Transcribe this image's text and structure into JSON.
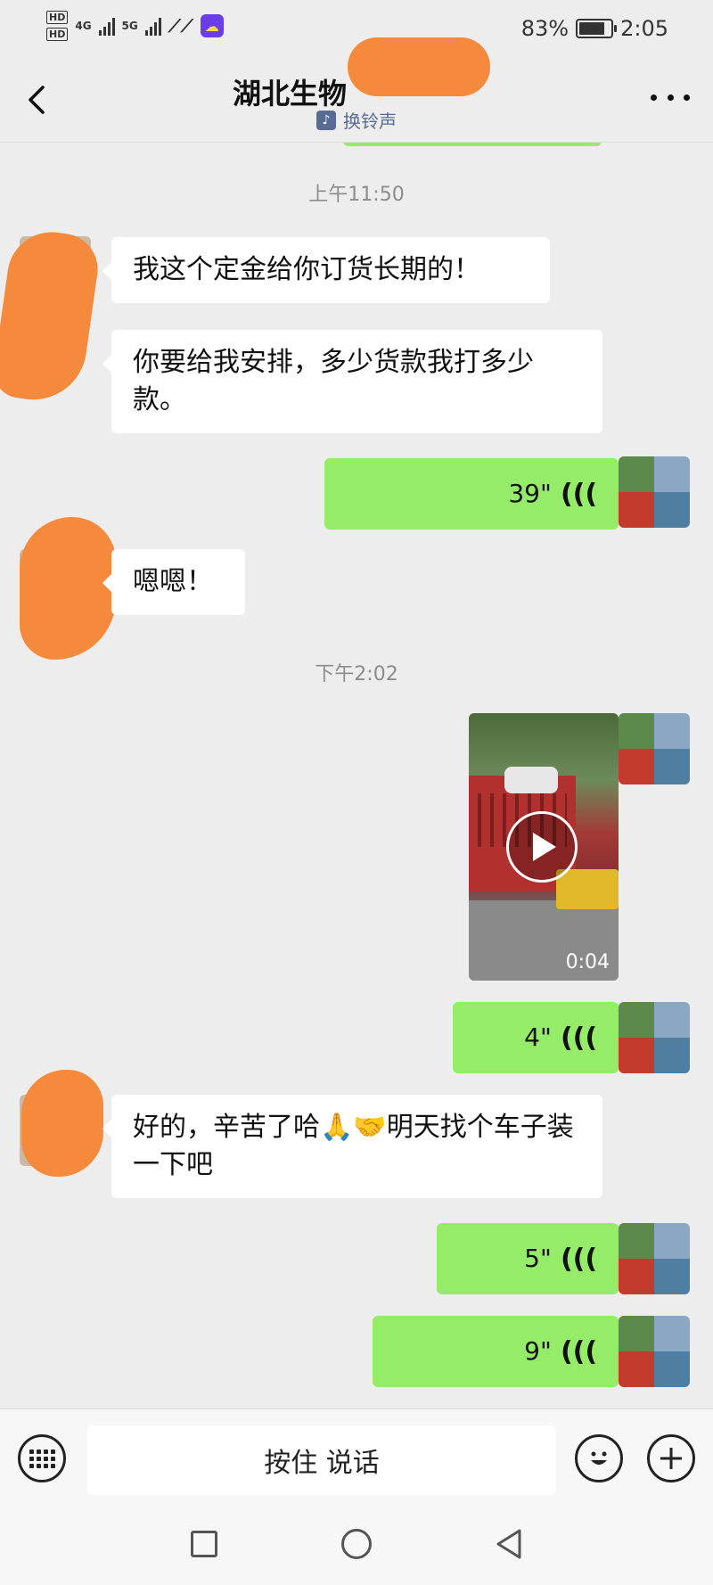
{
  "status_bar": {
    "sim1": "HD",
    "sim2": "HD",
    "net1": "4G",
    "net2": "5G",
    "battery": "83%",
    "battery_level": 0.83,
    "time": "2:05"
  },
  "header": {
    "title": "湖北生物",
    "subtitle": "换铃声"
  },
  "messages": {
    "ts1": "上午11:50",
    "m1": "我这个定金给你订货长期的！",
    "m2": "你要给我安排，多少货款我打多少款。",
    "v1": "39\"",
    "m3": "嗯嗯！",
    "ts2": "下午2:02",
    "video_duration": "0:04",
    "v2": "4\"",
    "m4": "好的，辛苦了哈🙏🤝明天找个车子装一下吧",
    "v3": "5\"",
    "v4": "9\""
  },
  "input_bar": {
    "talk_label": "按住 说话"
  },
  "colors": {
    "bubble_out": "#95ec69",
    "bubble_in": "#ffffff",
    "background": "#ededed",
    "link": "#576b95"
  }
}
